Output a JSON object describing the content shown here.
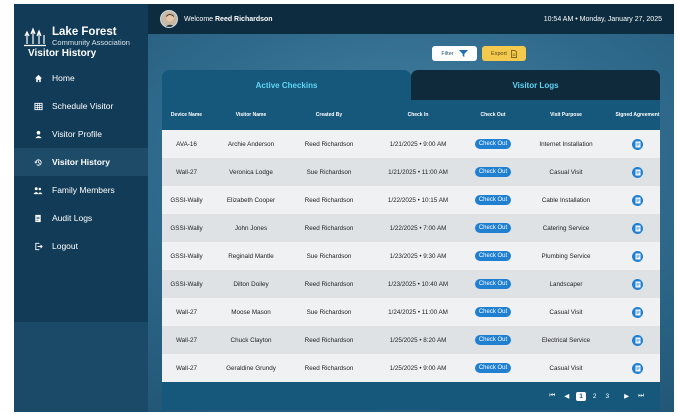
{
  "brand": {
    "title": "Lake Forest",
    "subtitle": "Community Association"
  },
  "topbar": {
    "welcome_prefix": "Welcome",
    "user_name": "Reed Richardson",
    "datetime": "10:54 AM • Monday, January 27, 2025"
  },
  "sidebar": {
    "items": [
      {
        "label": "Home",
        "icon": "home-icon"
      },
      {
        "label": "Schedule Visitor",
        "icon": "calendar-grid-icon"
      },
      {
        "label": "Visitor Profile",
        "icon": "person-icon"
      },
      {
        "label": "Visitor History",
        "icon": "history-icon",
        "active": true
      },
      {
        "label": "Family Members",
        "icon": "people-icon"
      },
      {
        "label": "Audit Logs",
        "icon": "document-icon"
      },
      {
        "label": "Logout",
        "icon": "logout-icon"
      }
    ]
  },
  "page": {
    "title": "Visitor History",
    "filter_label": "Filter",
    "export_label": "Export"
  },
  "tabs": {
    "active": "Active Checkins",
    "inactive": "Visitor Logs"
  },
  "table": {
    "headers": [
      "Device Name",
      "Visitor Name",
      "Created By",
      "Check In",
      "Check Out",
      "Visit Purpose",
      "Signed Agreement"
    ],
    "checkout_label": "Check Out",
    "rows": [
      {
        "device": "AVA-16",
        "visitor": "Archie Anderson",
        "created_by": "Reed Richardson",
        "check_in": "1/21/2025 • 9:00 AM",
        "purpose": "Internet Installation"
      },
      {
        "device": "Wall-27",
        "visitor": "Veronica Lodge",
        "created_by": "Sue Richardson",
        "check_in": "1/21/2025 • 11:00 AM",
        "purpose": "Casual Visit"
      },
      {
        "device": "GSSI-Wally",
        "visitor": "Elizabeth Cooper",
        "created_by": "Reed Richardson",
        "check_in": "1/22/2025 • 10:15 AM",
        "purpose": "Cable Installation"
      },
      {
        "device": "GSSI-Wally",
        "visitor": "John Jones",
        "created_by": "Reed Richardson",
        "check_in": "1/22/2025 • 7:00 AM",
        "purpose": "Catering Service"
      },
      {
        "device": "GSSI-Wally",
        "visitor": "Reginald Mantle",
        "created_by": "Sue Richardson",
        "check_in": "1/23/2025 • 9:30 AM",
        "purpose": "Plumbing Service"
      },
      {
        "device": "GSSI-Wally",
        "visitor": "Dilton Doiley",
        "created_by": "Reed Richardson",
        "check_in": "1/23/2025 • 10:40 AM",
        "purpose": "Landscaper"
      },
      {
        "device": "Wall-27",
        "visitor": "Moose Mason",
        "created_by": "Sue Richardson",
        "check_in": "1/24/2025 • 11:00 AM",
        "purpose": "Casual Visit"
      },
      {
        "device": "Wall-27",
        "visitor": "Chuck Clayton",
        "created_by": "Reed Richardson",
        "check_in": "1/25/2025 • 8:20 AM",
        "purpose": "Electrical Service"
      },
      {
        "device": "Wall-27",
        "visitor": "Geraldine Grundy",
        "created_by": "Reed Richardson",
        "check_in": "1/25/2025 • 9:00 AM",
        "purpose": "Casual Visit"
      }
    ]
  },
  "pagination": {
    "pages": [
      "1",
      "2",
      "3"
    ],
    "current": "1"
  },
  "colors": {
    "accent": "#1f7fd1",
    "tab_text": "#5fd5f4",
    "export": "#f3c94e",
    "sidebar": "#123b57"
  }
}
